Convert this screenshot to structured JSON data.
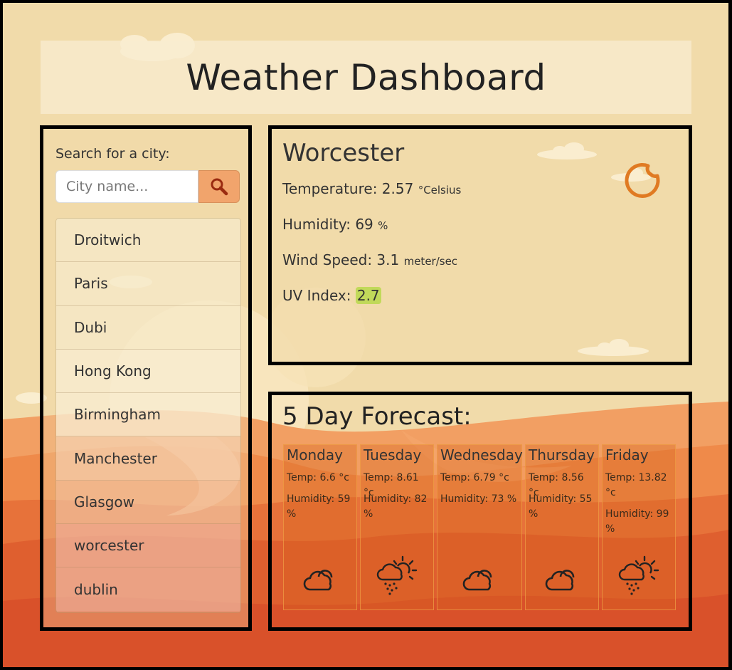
{
  "header": {
    "title": "Weather Dashboard"
  },
  "search": {
    "label": "Search for a city:",
    "placeholder": "City name...",
    "value": "",
    "button_icon": "search-icon",
    "history": [
      "Droitwich",
      "Paris",
      "Dubi",
      "Hong Kong",
      "Birmingham",
      "Manchester",
      "Glasgow",
      "worcester",
      "dublin"
    ]
  },
  "current": {
    "city": "Worcester",
    "temperature_label": "Temperature:",
    "temperature_value": "2.57",
    "temperature_unit": "°Celsius",
    "humidity_label": "Humidity:",
    "humidity_value": "69",
    "humidity_unit": "%",
    "wind_label": "Wind Speed:",
    "wind_value": "3.1",
    "wind_unit": "meter/sec",
    "uv_label": "UV Index:",
    "uv_value": "2.7",
    "uv_color": "#c1d95a",
    "icon": "moon-icon"
  },
  "forecast": {
    "title": "5 Day Forecast:",
    "days": [
      {
        "day": "Monday",
        "temp": "Temp: 6.6 °c",
        "humidity": "Humidity: 59 %",
        "icon": "cloud-icon"
      },
      {
        "day": "Tuesday",
        "temp": "Temp: 8.61 °c",
        "humidity": "Humidity: 82 %",
        "icon": "rain-sun-icon"
      },
      {
        "day": "Wednesday",
        "temp": "Temp: 6.79 °c",
        "humidity": "Humidity: 73 %",
        "icon": "cloud-icon"
      },
      {
        "day": "Thursday",
        "temp": "Temp: 8.56 °c",
        "humidity": "Humidity: 55 %",
        "icon": "cloud-icon"
      },
      {
        "day": "Friday",
        "temp": "Temp: 13.82 °c",
        "humidity": "Humidity: 99 %",
        "icon": "rain-sun-icon"
      }
    ]
  },
  "colors": {
    "sand": "#f1dbaa",
    "dune_light": "#f59a5c",
    "dune_dark": "#d9502a",
    "accent": "#e67e22"
  }
}
